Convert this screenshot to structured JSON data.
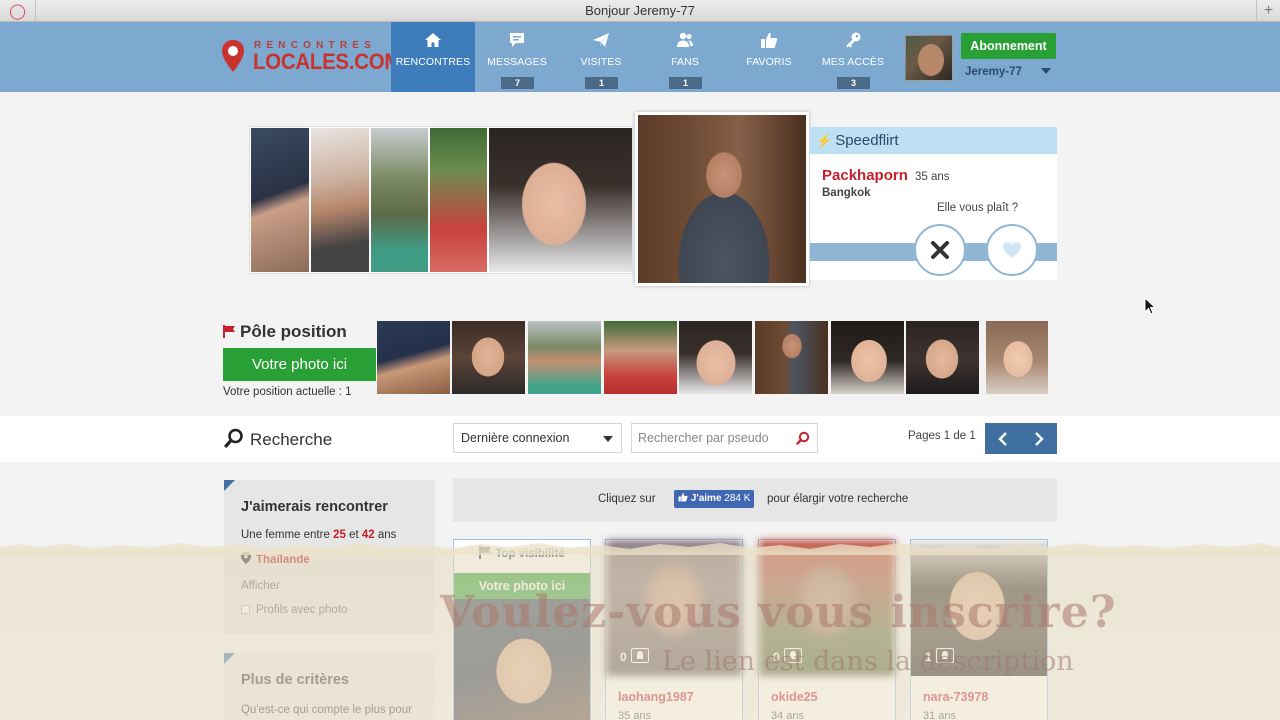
{
  "window": {
    "title": "Bonjour Jeremy-77"
  },
  "logo": {
    "line1": "RENCONTRES",
    "line2": "LOCALES.COM"
  },
  "nav": [
    {
      "label": "RENCONTRES",
      "badge": "",
      "icon": "home-icon"
    },
    {
      "label": "MESSAGES",
      "badge": "7",
      "icon": "chat-bubble-icon"
    },
    {
      "label": "VISITES",
      "badge": "1",
      "icon": "paper-plane-icon"
    },
    {
      "label": "FANS",
      "badge": "1",
      "icon": "users-icon"
    },
    {
      "label": "FAVORIS",
      "badge": "",
      "icon": "thumbs-up-icon"
    },
    {
      "label": "MES ACCÈS",
      "badge": "3",
      "icon": "key-icon"
    }
  ],
  "user": {
    "subscribe_label": "Abonnement",
    "username": "Jeremy-77"
  },
  "speedflirt": {
    "title": "Speedflirt",
    "name": "Packhaporn",
    "age": "35 ans",
    "city": "Bangkok",
    "question": "Elle vous plaît ?"
  },
  "pole": {
    "title": "Pôle position",
    "button": "Votre photo ici",
    "position": "Votre position actuelle : 1"
  },
  "search": {
    "label": "Recherche",
    "sort_selected": "Dernière connexion",
    "pseudo_placeholder": "Rechercher par pseudo",
    "pages": "Pages 1 de 1"
  },
  "filters": {
    "title": "J'aimerais rencontrer",
    "line_prefix": "Une femme entre",
    "age_min": "25",
    "line_mid": "et",
    "age_max": "42",
    "line_suffix": "ans",
    "country": "Thaïlande",
    "show_label": "Afficher",
    "photo_only_label": "Profils avec photo"
  },
  "more_criteria": {
    "title": "Plus de critères",
    "text": "Qu'est-ce qui compte le plus pour"
  },
  "facebook": {
    "prefix": "Cliquez sur",
    "like_label": "J'aime",
    "like_count": "284 K",
    "suffix": "pour élargir votre recherche"
  },
  "cards": {
    "top_label": "Top visibilité",
    "top_button": "Votre photo ici",
    "items": [
      {
        "name": "laohang1987",
        "age": "35 ans",
        "photos": "0"
      },
      {
        "name": "okide25",
        "age": "34 ans",
        "photos": "0"
      },
      {
        "name": "nara-73978",
        "age": "31 ans",
        "photos": "1"
      }
    ]
  },
  "overlay": {
    "line1": "Voulez-vous vous inscrire?",
    "line2": "Le lien est dans la description"
  },
  "colors": {
    "header": "#7da9d1",
    "active_nav": "#3f7cbc",
    "brand_red": "#c5202c",
    "green": "#29a035",
    "speed_head": "#bde0f5"
  }
}
